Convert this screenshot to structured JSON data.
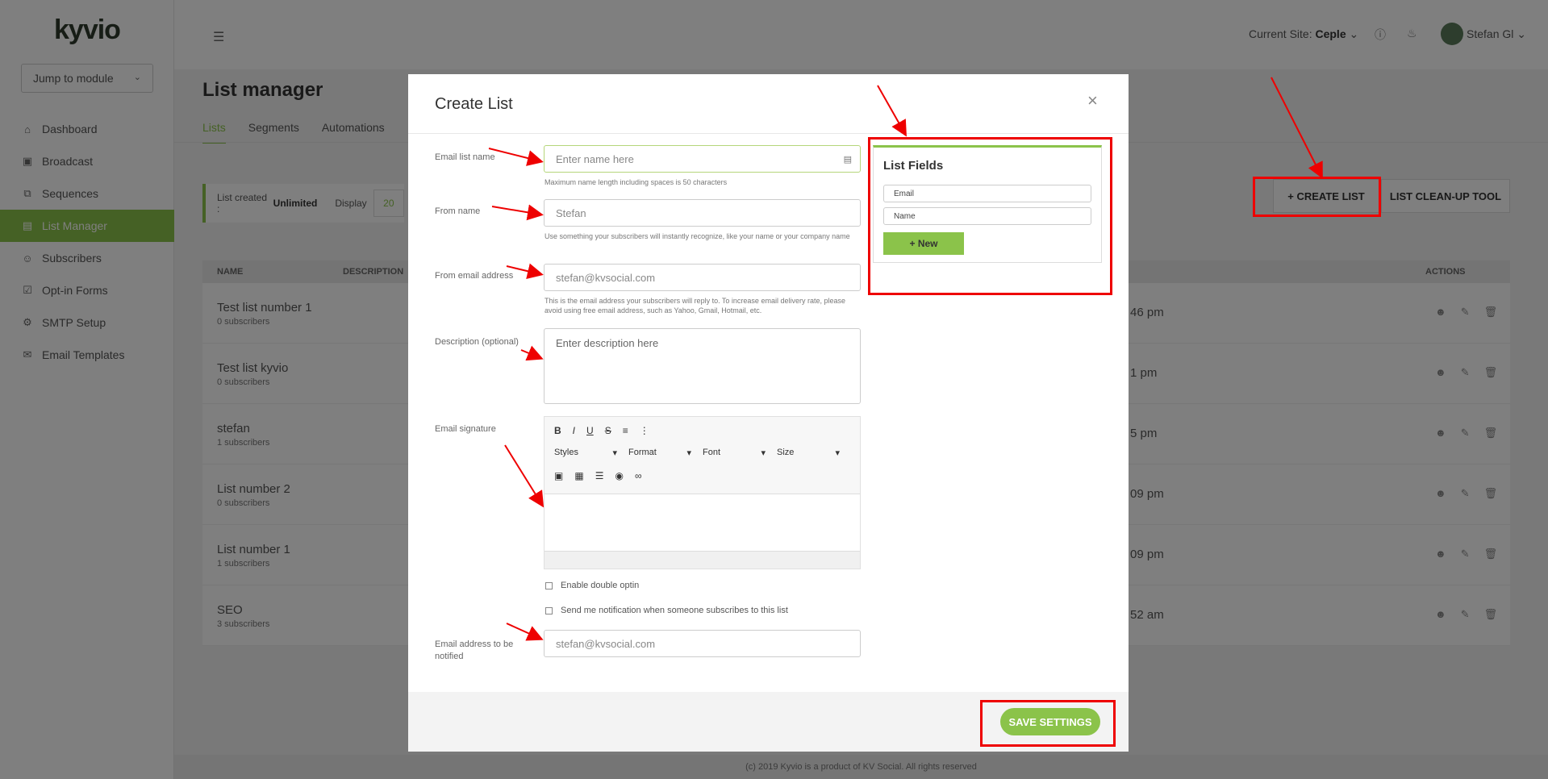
{
  "app": {
    "logo": "kyvio"
  },
  "sidebar": {
    "jump_label": "Jump to module",
    "items": [
      {
        "label": "Dashboard",
        "icon": "home-icon"
      },
      {
        "label": "Broadcast",
        "icon": "briefcase-icon"
      },
      {
        "label": "Sequences",
        "icon": "sequence-icon"
      },
      {
        "label": "List Manager",
        "icon": "list-icon"
      },
      {
        "label": "Subscribers",
        "icon": "users-icon"
      },
      {
        "label": "Opt-in Forms",
        "icon": "checkbox-icon"
      },
      {
        "label": "SMTP Setup",
        "icon": "gear-icon"
      },
      {
        "label": "Email Templates",
        "icon": "envelope-icon"
      }
    ]
  },
  "header": {
    "current_site_label": "Current Site:",
    "current_site": "Ceple",
    "user_name": "Stefan Gl"
  },
  "page": {
    "title": "List manager",
    "tabs": [
      "Lists",
      "Segments",
      "Automations"
    ],
    "list_created_label": "List created :",
    "list_created_value": "Unlimited",
    "display_label": "Display",
    "display_value": "20",
    "create_list_label": "+ CREATE LIST",
    "cleanup_label": "LIST CLEAN-UP TOOL"
  },
  "table": {
    "headers": {
      "name": "NAME",
      "description": "DESCRIPTION",
      "actions": "ACTIONS"
    },
    "rows": [
      {
        "name": "Test list number 1",
        "subs": "0 subscribers",
        "date": "46 pm"
      },
      {
        "name": "Test list kyvio",
        "subs": "0 subscribers",
        "date": "1 pm"
      },
      {
        "name": "stefan",
        "subs": "1 subscribers",
        "date": "5 pm"
      },
      {
        "name": "List number 2",
        "subs": "0 subscribers",
        "date": "09 pm"
      },
      {
        "name": "List number 1",
        "subs": "1 subscribers",
        "date": "09 pm"
      },
      {
        "name": "SEO",
        "subs": "3 subscribers",
        "date": "52 am"
      }
    ]
  },
  "footer": {
    "text": "(c) 2019 Kyvio is a product of KV Social. All rights reserved"
  },
  "modal": {
    "title": "Create List",
    "close_icon": "×",
    "email_list_name_label": "Email list name",
    "email_list_name_placeholder": "Enter name here",
    "email_list_name_help": "Maximum name length including spaces is 50 characters",
    "from_name_label": "From name",
    "from_name_value": "Stefan",
    "from_name_help": "Use something your subscribers will instantly recognize, like your name or your company name",
    "from_email_label": "From email address",
    "from_email_value": "stefan@kvsocial.com",
    "from_email_help": "This is the email address your subscribers will reply to. To increase email delivery rate, please avoid using free email address, such as Yahoo, Gmail, Hotmail, etc.",
    "description_label": "Description (optional)",
    "description_placeholder": "Enter description here",
    "signature_label": "Email signature",
    "editor": {
      "styles": "Styles",
      "format": "Format",
      "font": "Font",
      "size": "Size"
    },
    "double_optin_label": "Enable double optin",
    "notify_label": "Send me notification when someone subscribes to this list",
    "notify_email_label": "Email address to be notified",
    "notify_email_value": "stefan@kvsocial.com",
    "save_label": "SAVE SETTINGS",
    "list_fields": {
      "title": "List Fields",
      "fields": [
        "Email",
        "Name"
      ],
      "new_label": "+ New"
    }
  },
  "colors": {
    "accent": "#8bc34a",
    "annotation": "#e00000"
  }
}
